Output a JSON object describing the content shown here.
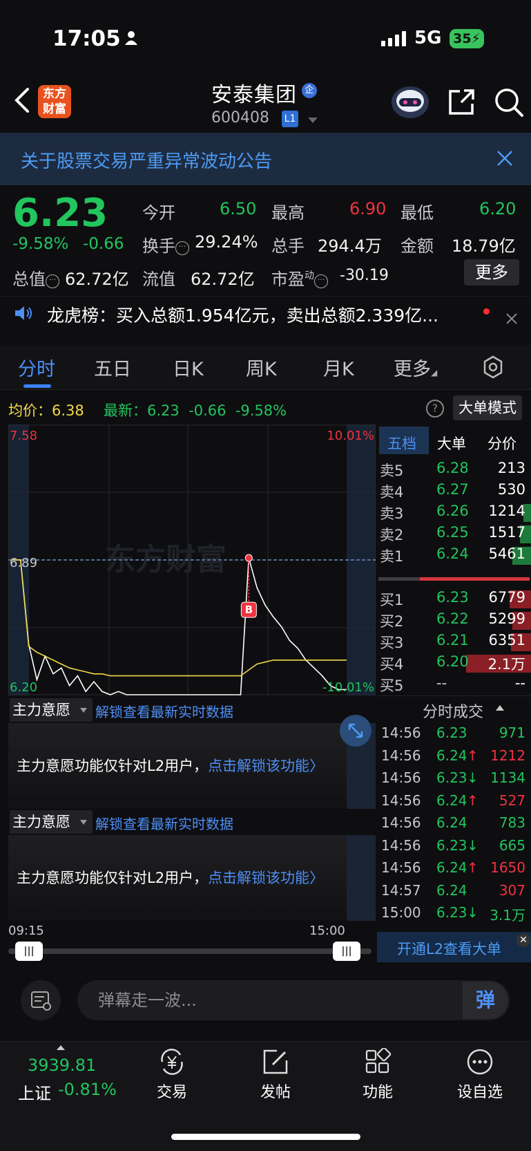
{
  "status": {
    "time": "17:05",
    "network": "5G",
    "battery": "35"
  },
  "header": {
    "logo_line1": "东方",
    "logo_line2": "财富",
    "stock_name": "安泰集团",
    "badge_qi": "企",
    "stock_code": "600408",
    "level_badge": "L1"
  },
  "notice": {
    "text": "关于股票交易严重异常波动公告"
  },
  "quote": {
    "price": "6.23",
    "change_pct": "-9.58%",
    "change": "-0.66",
    "open_label": "今开",
    "open": "6.50",
    "high_label": "最高",
    "high": "6.90",
    "low_label": "最低",
    "low": "6.20",
    "turnover_label": "换手",
    "turnover": "29.24%",
    "volume_label": "总手",
    "volume": "294.4万",
    "amount_label": "金额",
    "amount": "18.79亿",
    "mktcap_label": "总值",
    "mktcap": "62.72亿",
    "float_label": "流值",
    "float": "62.72亿",
    "pe_label": "市盈",
    "pe_sup": "动",
    "pe": "-30.19",
    "more_label": "更多"
  },
  "news": {
    "text": "龙虎榜：买入总额1.954亿元，卖出总额2.339亿..."
  },
  "tabs": [
    "分时",
    "五日",
    "日K",
    "周K",
    "月K",
    "更多"
  ],
  "chart_info": {
    "avg_label": "均价：6.38",
    "latest_label": "最新：6.23",
    "latest_change": "-0.66",
    "latest_pct": "-9.58%",
    "mode_button": "大单模式",
    "help": "?"
  },
  "chart_data": {
    "type": "line",
    "title": "",
    "y_top_label": "7.58",
    "y_mid_label": "6.89",
    "y_bottom_label": "6.20",
    "pct_top_label": "10.01%",
    "pct_bottom_label": "-10.01%",
    "ylim": [
      6.2,
      7.58
    ],
    "prev_close": 6.89,
    "x_start": "09:15",
    "x_end": "15:00",
    "watermark": "东方财富",
    "marker": "B",
    "series": [
      {
        "name": "price",
        "values": [
          6.89,
          6.89,
          6.46,
          6.28,
          6.4,
          6.31,
          6.34,
          6.25,
          6.3,
          6.22,
          6.27,
          6.22,
          6.2,
          6.22,
          6.2,
          6.2,
          6.2,
          6.2,
          6.2,
          6.2,
          6.2,
          6.2,
          6.2,
          6.2,
          6.2,
          6.2,
          6.2,
          6.2,
          6.2,
          6.9,
          6.75,
          6.66,
          6.6,
          6.55,
          6.48,
          6.44,
          6.38,
          6.34,
          6.3,
          6.25,
          6.23,
          6.23
        ]
      },
      {
        "name": "avg",
        "values": [
          6.89,
          6.89,
          6.45,
          6.42,
          6.4,
          6.38,
          6.36,
          6.34,
          6.33,
          6.32,
          6.31,
          6.31,
          6.3,
          6.3,
          6.3,
          6.3,
          6.3,
          6.3,
          6.3,
          6.3,
          6.3,
          6.3,
          6.3,
          6.3,
          6.3,
          6.3,
          6.3,
          6.3,
          6.3,
          6.33,
          6.36,
          6.37,
          6.38,
          6.38,
          6.38,
          6.38,
          6.38,
          6.38,
          6.38,
          6.38,
          6.38,
          6.38
        ]
      }
    ]
  },
  "orderbook": {
    "tabs": [
      "五档",
      "大单",
      "分价"
    ],
    "asks": [
      {
        "label": "卖5",
        "price": "6.28",
        "vol": "213",
        "bar": 0.0
      },
      {
        "label": "卖4",
        "price": "6.27",
        "vol": "530",
        "bar": 0.0
      },
      {
        "label": "卖3",
        "price": "6.26",
        "vol": "1214",
        "bar": 0.05
      },
      {
        "label": "卖2",
        "price": "6.25",
        "vol": "1517",
        "bar": 0.07
      },
      {
        "label": "卖1",
        "price": "6.24",
        "vol": "5461",
        "bar": 0.12
      }
    ],
    "bids": [
      {
        "label": "买1",
        "price": "6.23",
        "vol": "6779",
        "bar": 0.14
      },
      {
        "label": "买2",
        "price": "6.22",
        "vol": "5299",
        "bar": 0.12
      },
      {
        "label": "买3",
        "price": "6.21",
        "vol": "6351",
        "bar": 0.13
      },
      {
        "label": "买4",
        "price": "6.20",
        "vol": "2.1万",
        "bar": 0.42
      },
      {
        "label": "买5",
        "price": "--",
        "vol": "--",
        "bar": 0.0
      }
    ]
  },
  "panels": {
    "title": "主力意愿",
    "link": "解锁查看最新实时数据",
    "msg": "主力意愿功能仅针对L2用户，",
    "msg_link": "点击解锁该功能"
  },
  "trades": {
    "title": "分时成交",
    "rows": [
      {
        "time": "14:56",
        "price": "6.23",
        "arrow": "",
        "vol": "971",
        "pcolor": "green",
        "vcolor": "green"
      },
      {
        "time": "14:56",
        "price": "6.24",
        "arrow": "↑",
        "vol": "1212",
        "pcolor": "green",
        "vcolor": "red"
      },
      {
        "time": "14:56",
        "price": "6.23",
        "arrow": "↓",
        "vol": "1134",
        "pcolor": "green",
        "vcolor": "green"
      },
      {
        "time": "14:56",
        "price": "6.24",
        "arrow": "↑",
        "vol": "527",
        "pcolor": "green",
        "vcolor": "red"
      },
      {
        "time": "14:56",
        "price": "6.24",
        "arrow": "",
        "vol": "783",
        "pcolor": "green",
        "vcolor": "green"
      },
      {
        "time": "14:56",
        "price": "6.23",
        "arrow": "↓",
        "vol": "665",
        "pcolor": "green",
        "vcolor": "green"
      },
      {
        "time": "14:56",
        "price": "6.24",
        "arrow": "↑",
        "vol": "1650",
        "pcolor": "green",
        "vcolor": "red"
      },
      {
        "time": "14:57",
        "price": "6.24",
        "arrow": "",
        "vol": "307",
        "pcolor": "green",
        "vcolor": "red"
      },
      {
        "time": "15:00",
        "price": "6.23",
        "arrow": "↓",
        "vol": "3.1万",
        "pcolor": "green",
        "vcolor": "green"
      }
    ],
    "l2_banner": "开通L2查看大单"
  },
  "danmaku": {
    "placeholder": "弹幕走一波...",
    "send": "弹"
  },
  "bottom_nav": {
    "index_value": "3939.81",
    "index_name": "上证",
    "index_pct": "-0.81%",
    "items": [
      "交易",
      "发帖",
      "功能",
      "设自选"
    ]
  },
  "colors": {
    "up": "#ef3340",
    "down": "#22c55e",
    "accent": "#3b82f6",
    "avg_line": "#f5d94a"
  }
}
